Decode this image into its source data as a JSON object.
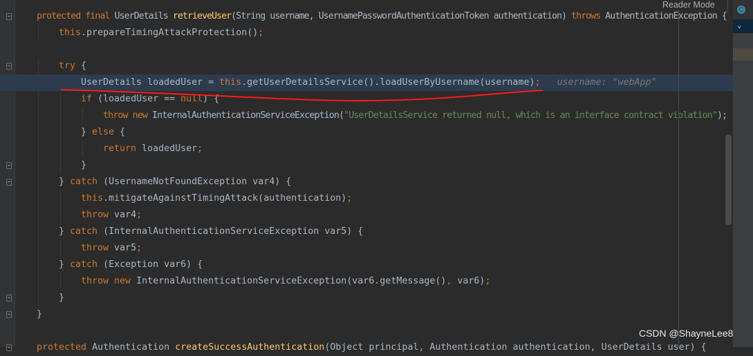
{
  "editor": {
    "reader_mode_label": "Reader Mode",
    "watermark": "CSDN @ShayneLee8",
    "highlighted_line": 4,
    "lines": [
      {
        "indent": 0,
        "tokens": [
          [
            "kw",
            "protected final "
          ],
          [
            "",
            "UserDetails "
          ],
          [
            "fn",
            "retrieveUser"
          ],
          [
            "",
            "(String username, UsernamePasswordAuthenticationToken authentication) "
          ],
          [
            "kw",
            "throws "
          ],
          [
            "",
            "AuthenticationException {"
          ]
        ]
      },
      {
        "indent": 1,
        "tokens": [
          [
            "kw",
            "this"
          ],
          [
            "",
            "."
          ],
          [
            "",
            "prepareTimingAttackProtection()"
          ],
          [
            "kw",
            ";"
          ]
        ]
      },
      {
        "indent": 0,
        "tokens": []
      },
      {
        "indent": 1,
        "tokens": [
          [
            "kw",
            "try "
          ],
          [
            "",
            "{"
          ]
        ]
      },
      {
        "indent": 2,
        "tokens": [
          [
            "",
            "UserDetails loadedUser = "
          ],
          [
            "kw",
            "this"
          ],
          [
            "",
            ".getUserDetailsService().loadUserByUsername(username)"
          ],
          [
            "kw",
            ";"
          ],
          [
            "hint",
            "   username: \"webApp\""
          ]
        ]
      },
      {
        "indent": 2,
        "tokens": [
          [
            "kw",
            "if "
          ],
          [
            "",
            "(loadedUser == "
          ],
          [
            "kw",
            "null"
          ],
          [
            "",
            ") {"
          ]
        ]
      },
      {
        "indent": 3,
        "tokens": [
          [
            "kw",
            "throw new "
          ],
          [
            "",
            "InternalAuthenticationServiceException("
          ],
          [
            "str",
            "\"UserDetailsService returned null, which is an interface contract violation\""
          ],
          [
            "",
            ");"
          ]
        ]
      },
      {
        "indent": 2,
        "tokens": [
          [
            "",
            "} "
          ],
          [
            "kw",
            "else "
          ],
          [
            "",
            "{"
          ]
        ]
      },
      {
        "indent": 3,
        "tokens": [
          [
            "kw",
            "return "
          ],
          [
            "",
            "loadedUser"
          ],
          [
            "kw",
            ";"
          ]
        ]
      },
      {
        "indent": 2,
        "tokens": [
          [
            "",
            "}"
          ]
        ]
      },
      {
        "indent": 1,
        "tokens": [
          [
            "",
            "} "
          ],
          [
            "kw",
            "catch "
          ],
          [
            "",
            "(UsernameNotFoundException var4) {"
          ]
        ]
      },
      {
        "indent": 2,
        "tokens": [
          [
            "kw",
            "this"
          ],
          [
            "",
            ".mitigateAgainstTimingAttack(authentication)"
          ],
          [
            "kw",
            ";"
          ]
        ]
      },
      {
        "indent": 2,
        "tokens": [
          [
            "kw",
            "throw "
          ],
          [
            "",
            "var4"
          ],
          [
            "kw",
            ";"
          ]
        ]
      },
      {
        "indent": 1,
        "tokens": [
          [
            "",
            "} "
          ],
          [
            "kw",
            "catch "
          ],
          [
            "",
            "(InternalAuthenticationServiceException var5) {"
          ]
        ]
      },
      {
        "indent": 2,
        "tokens": [
          [
            "kw",
            "throw "
          ],
          [
            "",
            "var5"
          ],
          [
            "kw",
            ";"
          ]
        ]
      },
      {
        "indent": 1,
        "tokens": [
          [
            "",
            "} "
          ],
          [
            "kw",
            "catch "
          ],
          [
            "",
            "(Exception var6) {"
          ]
        ]
      },
      {
        "indent": 2,
        "tokens": [
          [
            "kw",
            "throw new "
          ],
          [
            "",
            "InternalAuthenticationServiceException(var6.getMessage()"
          ],
          [
            "kw",
            ", "
          ],
          [
            "",
            "var6)"
          ],
          [
            "kw",
            ";"
          ]
        ]
      },
      {
        "indent": 1,
        "tokens": [
          [
            "",
            "}"
          ]
        ]
      },
      {
        "indent": 0,
        "tokens": [
          [
            "",
            "}"
          ]
        ]
      },
      {
        "indent": 0,
        "tokens": []
      },
      {
        "indent": 0,
        "tokens": [
          [
            "kw",
            "protected "
          ],
          [
            "",
            "Authentication "
          ],
          [
            "fn",
            "createSuccessAuthentication"
          ],
          [
            "",
            "(Object principal, Authentication authentication, UserDetails user) {"
          ]
        ]
      }
    ],
    "fold_lines": [
      0,
      3,
      9,
      10,
      17,
      18,
      20
    ]
  },
  "colors": {
    "background": "#2b2b2b",
    "keyword": "#cc7832",
    "text": "#a9b7c6",
    "method": "#ffc66d",
    "string": "#6a8759",
    "annotation": "#ff0000"
  },
  "right_panel": {
    "icon": "C"
  }
}
